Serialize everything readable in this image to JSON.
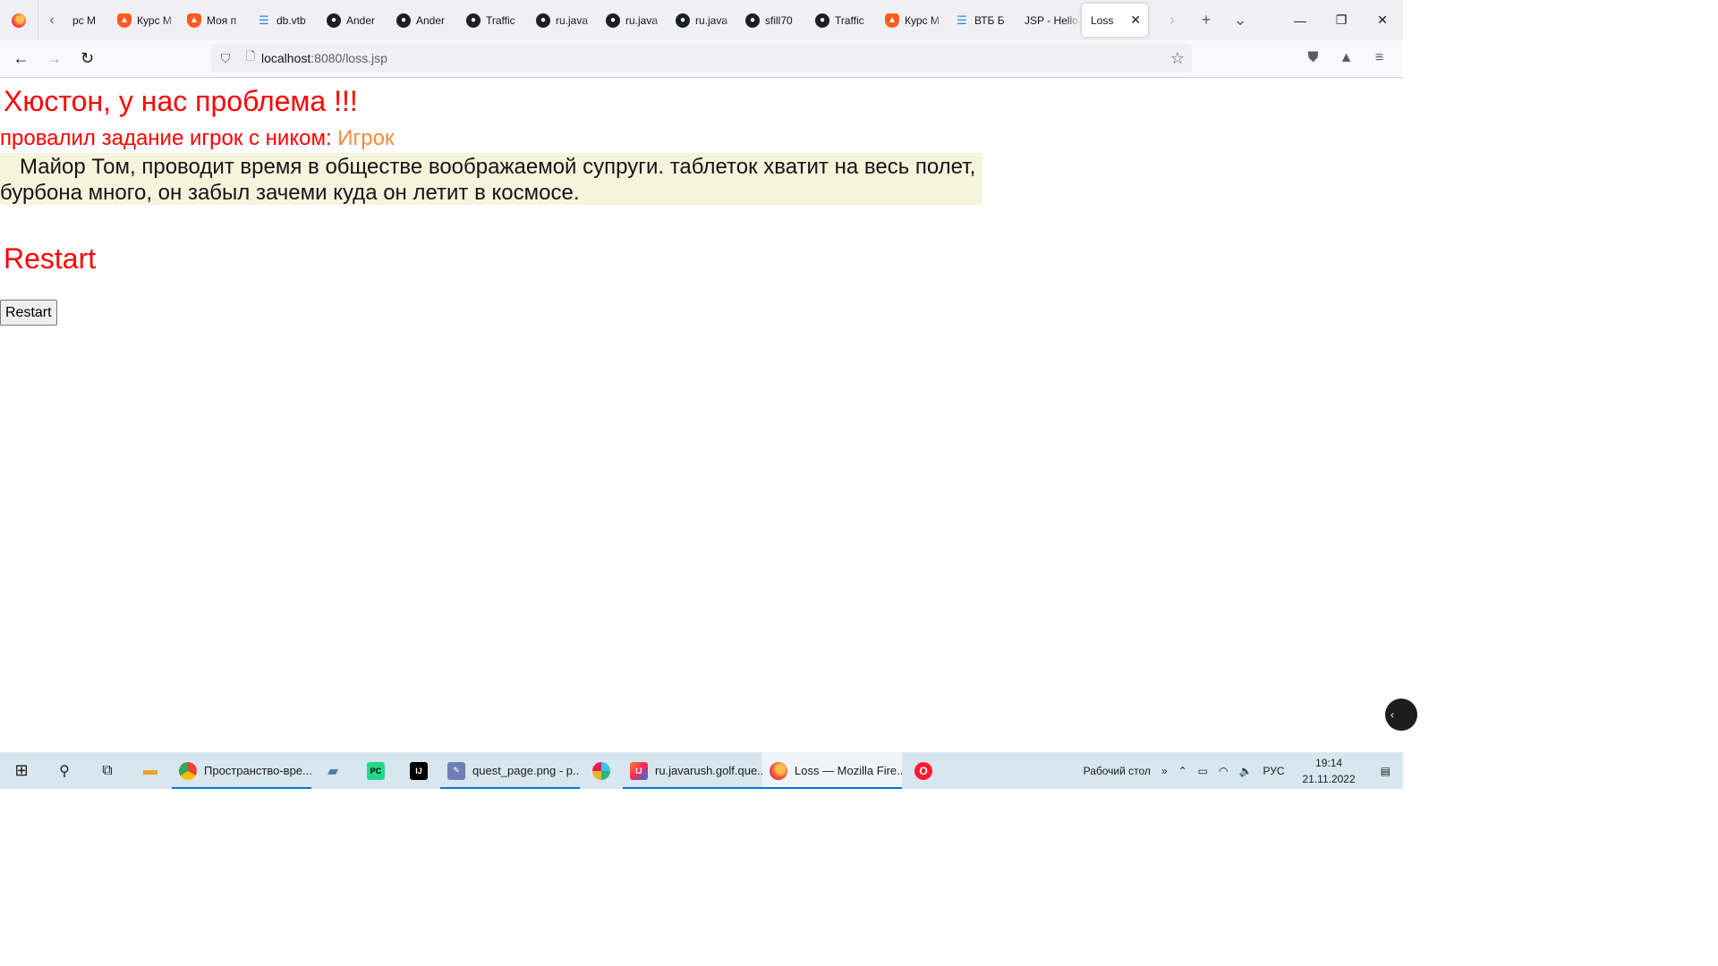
{
  "browser": {
    "tabs": [
      {
        "icon": "brave-icon",
        "label": "рс М"
      },
      {
        "icon": "brave-icon",
        "label": "Курс М"
      },
      {
        "icon": "brave-icon",
        "label": "Моя п"
      },
      {
        "icon": "db-icon",
        "label": "db.vtb"
      },
      {
        "icon": "github-icon",
        "label": "Ander"
      },
      {
        "icon": "github-icon",
        "label": "Ander"
      },
      {
        "icon": "github-icon",
        "label": "Traffic"
      },
      {
        "icon": "github-icon",
        "label": "ru.java"
      },
      {
        "icon": "github-icon",
        "label": "ru.java"
      },
      {
        "icon": "github-icon",
        "label": "ru.java"
      },
      {
        "icon": "github-icon",
        "label": "sfill70"
      },
      {
        "icon": "github-icon",
        "label": "Traffic"
      },
      {
        "icon": "brave-icon",
        "label": "Курс М"
      },
      {
        "icon": "db-icon",
        "label": "ВТБ Б"
      },
      {
        "icon": "none",
        "label": "JSP - Hello"
      }
    ],
    "active_tab": {
      "label": "Loss",
      "close": "✕"
    },
    "url": {
      "host": "localhost",
      "rest": ":8080/loss.jsp"
    }
  },
  "page": {
    "headline": "Хюстон, у нас проблема !!!",
    "player_prefix": "провалил задание игрок с ником:",
    "player_nick": "Игрок",
    "story": "Майор Том, проводит время в обществе воображаемой супруги. таблеток хватит на весь полет, бурбона много, он забыл зачеми куда он летит в космосе.",
    "restart_heading": "Restart",
    "restart_button": "Restart",
    "colors": {
      "heading": "#ff0000",
      "nick": "#f4893b",
      "story_bg": "#f5f5dc"
    }
  },
  "taskbar": {
    "apps": [
      {
        "icon": "chrome-icon",
        "label": "Пространство-вре...",
        "running": true
      },
      {
        "icon": "pycharm-icon",
        "label": "",
        "running": false
      },
      {
        "icon": "intellij-icon",
        "label": "",
        "running": false
      },
      {
        "icon": "paint-icon",
        "label": "quest_page.png - p...",
        "running": true
      },
      {
        "icon": "slack-icon",
        "label": "",
        "running": false
      },
      {
        "icon": "intellij-icon",
        "label": "ru.javarush.golf.que...",
        "running": true
      },
      {
        "icon": "firefox-icon",
        "label": "Loss — Mozilla Fire...",
        "running": true
      },
      {
        "icon": "opera-icon",
        "label": "",
        "running": false
      }
    ],
    "desktop_label": "Рабочий стол",
    "language": "РУС",
    "time": "19:14",
    "date": "21.11.2022"
  }
}
